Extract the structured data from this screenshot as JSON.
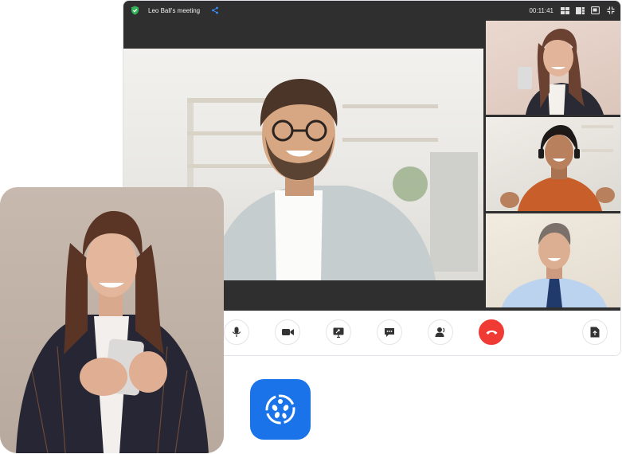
{
  "meeting": {
    "title": "Leo Ball's meeting",
    "timer": "00:11:41"
  },
  "icons": {
    "secure": "shield-check-icon",
    "share": "share-icon",
    "layout": "grid-layout-icon",
    "grid": "tile-view-icon",
    "pip": "picture-in-picture-icon",
    "fullscreen": "exit-fullscreen-icon"
  },
  "controls": [
    {
      "name": "microphone",
      "icon": "microphone-icon"
    },
    {
      "name": "camera",
      "icon": "video-camera-icon"
    },
    {
      "name": "screen-share",
      "icon": "screen-share-icon"
    },
    {
      "name": "chat",
      "icon": "chat-icon"
    },
    {
      "name": "participants",
      "icon": "participants-icon"
    },
    {
      "name": "end-call",
      "icon": "phone-hangup-icon"
    },
    {
      "name": "upload-file",
      "icon": "file-upload-icon"
    }
  ],
  "colors": {
    "accent": "#1a73e8",
    "end_call": "#ef3b34",
    "titlebar": "#2f2f30",
    "secure": "#34b35a"
  }
}
